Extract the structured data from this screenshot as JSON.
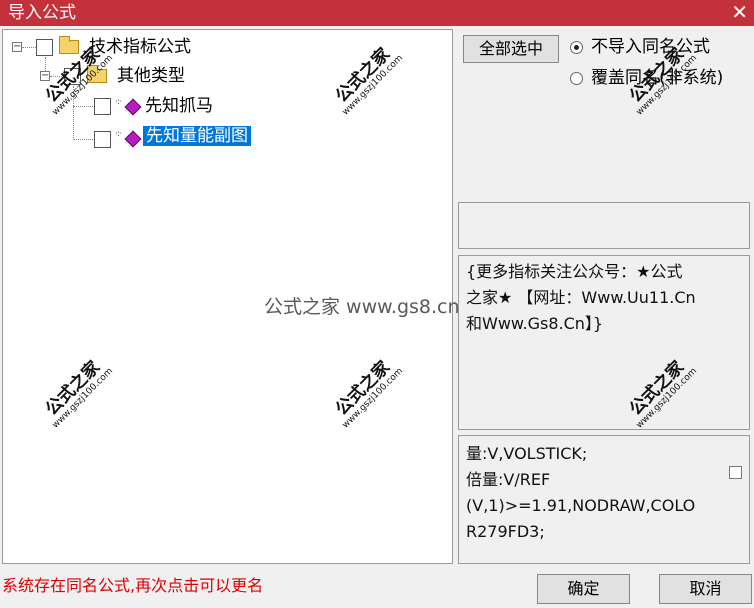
{
  "window": {
    "title": "导入公式",
    "close_glyph": "✕"
  },
  "tree": {
    "root": {
      "label": "技术指标公式",
      "expander": "⊟"
    },
    "group": {
      "label": "其他类型",
      "expander": "⊟"
    },
    "items": [
      {
        "label": "先知抓马",
        "selected": false
      },
      {
        "label": "先知量能副图",
        "selected": true
      }
    ]
  },
  "actions": {
    "select_all": "全部选中",
    "radio_options": [
      {
        "label": "不导入同名公式",
        "checked": true
      },
      {
        "label": "覆盖同名(非系统)",
        "checked": false
      }
    ],
    "ok": "确定",
    "cancel": "取消"
  },
  "description": [
    "{更多指标关注公众号：★公式",
    "之家★ 【网址：Www.Uu11.Cn",
    "和Www.Gs8.Cn】}"
  ],
  "code": [
    "量:V,VOLSTICK;",
    "倍量:V/REF",
    "(V,1)>=1.91,NODRAW,COLO",
    "R279FD3;"
  ],
  "status": "系统存在同名公式,再次点击可以更名",
  "watermark": {
    "main": "公式之家",
    "url": "www.gszj100.com",
    "center": "公式之家 www.gs8.cn"
  },
  "colors": {
    "titlebar": "#c3323b",
    "selection": "#0078d7",
    "status": "#e00000"
  }
}
